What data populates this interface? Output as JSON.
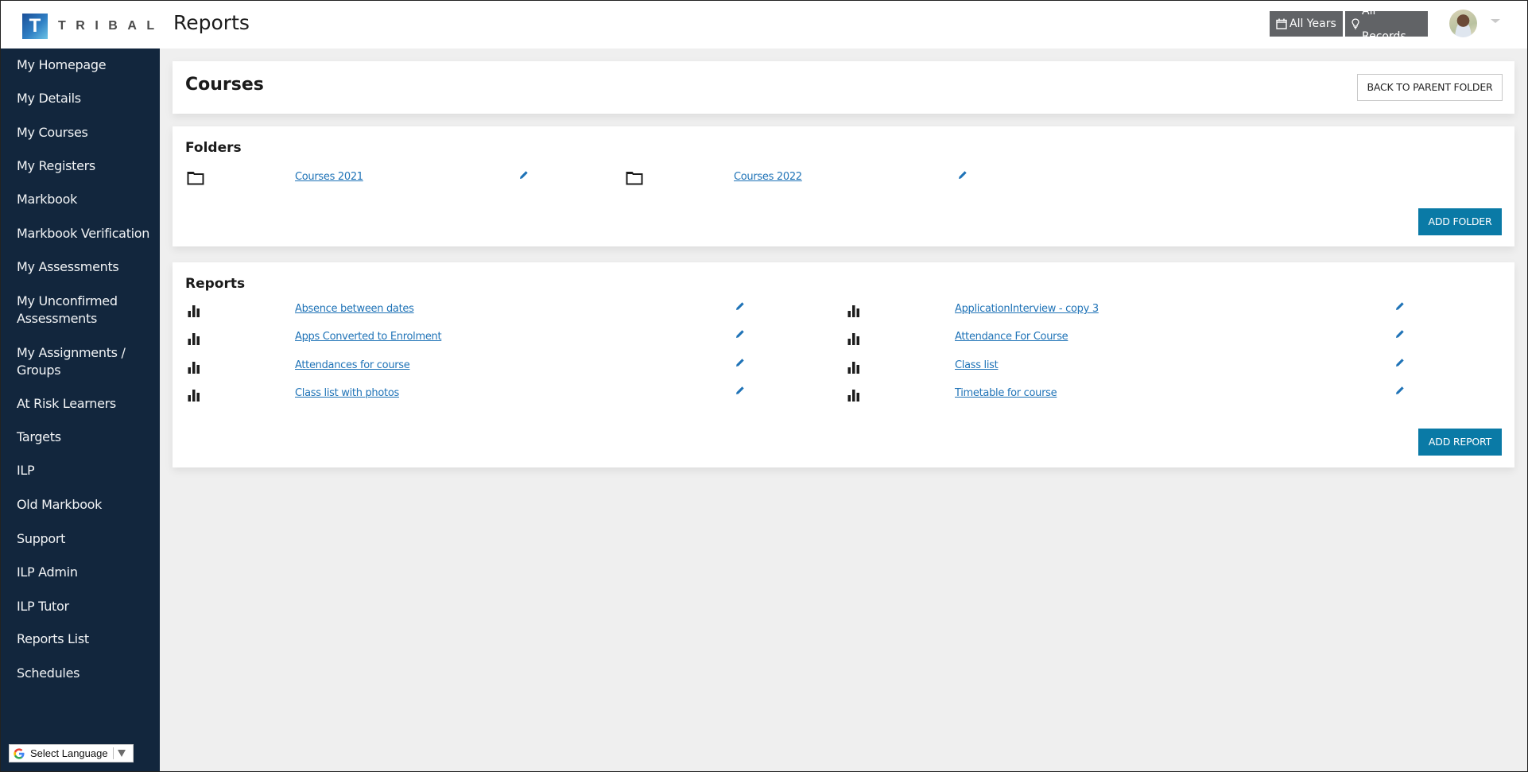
{
  "header": {
    "logo_letter": "T",
    "logo_text": "TRIBAL",
    "title": "Reports",
    "years_button": "All Years",
    "records_button": "All Records"
  },
  "sidebar": {
    "items": [
      {
        "label": "My Homepage"
      },
      {
        "label": "My Details"
      },
      {
        "label": "My Courses"
      },
      {
        "label": "My Registers"
      },
      {
        "label": "Markbook"
      },
      {
        "label": "Markbook Verification"
      },
      {
        "label": "My Assessments"
      },
      {
        "label": "My Unconfirmed Assessments"
      },
      {
        "label": "My Assignments / Groups"
      },
      {
        "label": "At Risk Learners"
      },
      {
        "label": "Targets"
      },
      {
        "label": "ILP"
      },
      {
        "label": "Old Markbook"
      },
      {
        "label": "Support"
      },
      {
        "label": "ILP Admin"
      },
      {
        "label": "ILP Tutor"
      },
      {
        "label": "Reports List"
      },
      {
        "label": "Schedules"
      }
    ],
    "language_selector": "Select Language"
  },
  "courses_card": {
    "title": "Courses",
    "back_button": "BACK TO PARENT FOLDER"
  },
  "folders_card": {
    "title": "Folders",
    "items": [
      {
        "name": "Courses 2021",
        "icon": "folder-icon"
      },
      {
        "name": "Courses 2022",
        "icon": "folder-icon"
      }
    ],
    "add_button": "ADD FOLDER"
  },
  "reports_card": {
    "title": "Reports",
    "items": [
      {
        "name": "Absence between dates",
        "icon": "bar-chart-icon"
      },
      {
        "name": "ApplicationInterview - copy 3",
        "icon": "bar-chart-icon"
      },
      {
        "name": "Apps Converted to Enrolment",
        "icon": "bar-chart-icon"
      },
      {
        "name": "Attendance For Course",
        "icon": "bar-chart-icon"
      },
      {
        "name": "Attendances for course",
        "icon": "bar-chart-icon"
      },
      {
        "name": "Class list",
        "icon": "bar-chart-icon"
      },
      {
        "name": "Class list with photos",
        "icon": "bar-chart-icon"
      },
      {
        "name": "Timetable for course",
        "icon": "bar-chart-icon"
      }
    ],
    "add_button": "ADD REPORT"
  },
  "colors": {
    "sidebar_bg": "#12263d",
    "primary_button": "#0a7aa6",
    "header_button": "#616366",
    "link": "#1f73b7"
  }
}
